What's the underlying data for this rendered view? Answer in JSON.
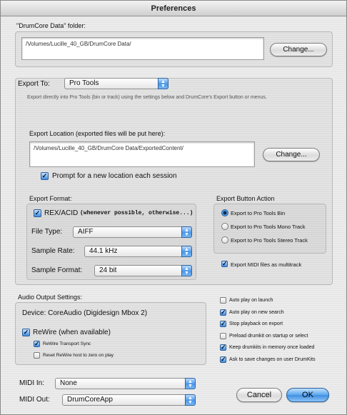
{
  "window": {
    "title": "Preferences"
  },
  "datafolder": {
    "label": "\"DrumCore Data\" folder:",
    "path": "/Volumes/Lucille_40_GB/DrumCore Data/",
    "change_label": "Change..."
  },
  "export": {
    "label": "Export To:",
    "target": "Pro Tools",
    "description": "Export directly into Pro Tools (bin or track) using the settings below and DrumCore's Export button or menus.",
    "location_label": "Export Location (exported files will be put here):",
    "location_path": "/Volumes/Lucille_40_GB/DrumCore Data/ExportedContent/",
    "location_change_label": "Change...",
    "prompt_label": "Prompt for a new location each session",
    "prompt_checked": true
  },
  "format": {
    "label": "Export Format:",
    "rex_label": "REX/ACID",
    "rex_note": "(whenever possible, otherwise...)",
    "rex_checked": true,
    "filetype_label": "File Type:",
    "filetype_value": "AIFF",
    "samplerate_label": "Sample Rate:",
    "samplerate_value": "44.1 kHz",
    "sampleformat_label": "Sample Format:",
    "sampleformat_value": "24 bit"
  },
  "button_action": {
    "label": "Export Button Action",
    "options": [
      "Export to Pro Tools Bin",
      "Export to Pro Tools Mono Track",
      "Export to Pro Tools Stereo Track"
    ],
    "selected": 0,
    "midi_multitrack_label": "Export MIDI files as multitrack",
    "midi_multitrack_checked": true
  },
  "audio": {
    "label": "Audio Output Settings:",
    "device": "Device: CoreAudio (Digidesign Mbox 2)",
    "rewire_label": "ReWire (when available)",
    "rewire_checked": true,
    "transport_sync_label": "ReWire Transport Sync",
    "transport_sync_checked": true,
    "reset_host_label": "Reset ReWire host to zero on play",
    "reset_host_checked": false
  },
  "options": [
    {
      "label": "Auto play on launch",
      "checked": false
    },
    {
      "label": "Auto play on new search",
      "checked": true
    },
    {
      "label": "Stop playback on export",
      "checked": true
    },
    {
      "label": "Preload drumkit on startup or select",
      "checked": false
    },
    {
      "label": "Keep drumkits in memory once loaded",
      "checked": true
    },
    {
      "label": "Ask to save changes on user DrumKits",
      "checked": true
    }
  ],
  "midi": {
    "in_label": "MIDI In:",
    "in_value": "None",
    "out_label": "MIDI Out:",
    "out_value": "DrumCoreApp"
  },
  "buttons": {
    "cancel": "Cancel",
    "ok": "OK"
  },
  "colors": {
    "accent": "#3f8fe0",
    "group_border": "#b9b9b9"
  }
}
